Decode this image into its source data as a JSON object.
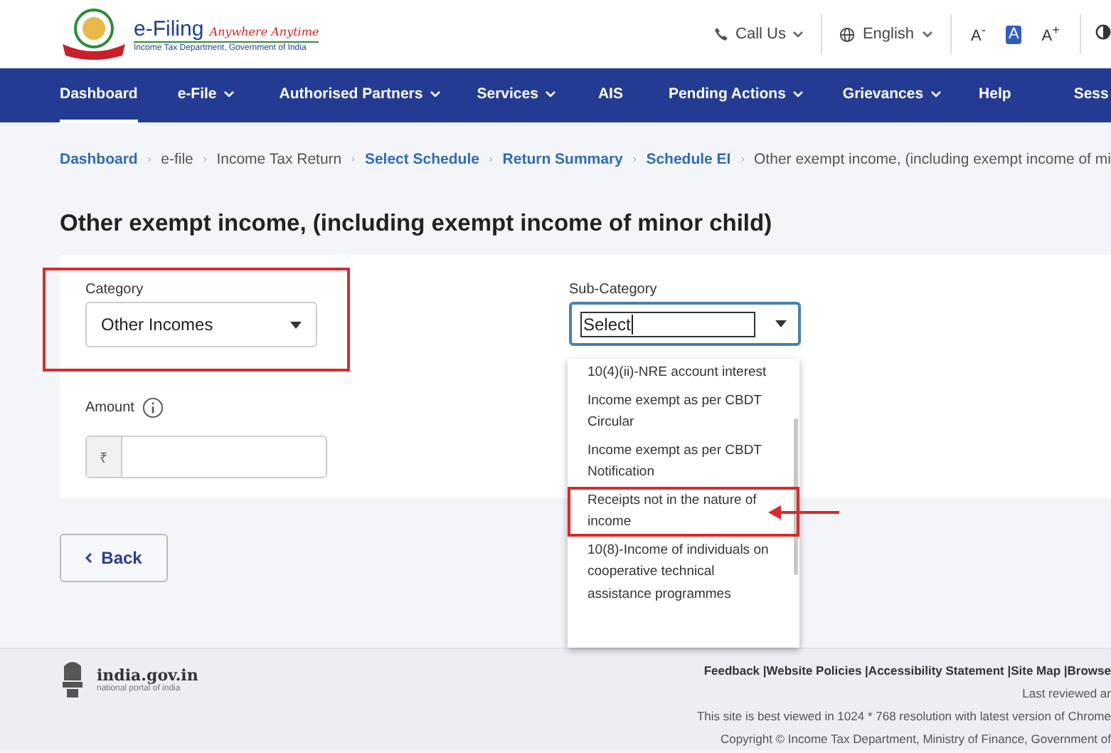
{
  "header": {
    "logo_title": "e-Filing",
    "logo_tagline": "Anywhere Anytime",
    "logo_subtitle": "Income Tax Department, Government of India",
    "call_us": "Call Us",
    "language": "English",
    "font_buttons": [
      {
        "label": "A$^{-}$",
        "selected": false
      },
      {
        "label": "A",
        "selected": true
      },
      {
        "label": "A$^{+}$",
        "selected": false
      }
    ]
  },
  "nav": [
    {
      "label": "Dashboard",
      "selected": true,
      "dropdown": false
    },
    {
      "label": "e-File",
      "selected": false,
      "dropdown": true
    },
    {
      "label": "Authorised Partners",
      "selected": false,
      "dropdown": true
    },
    {
      "label": "Services",
      "selected": false,
      "dropdown": true
    },
    {
      "label": "AIS",
      "selected": false,
      "dropdown": false
    },
    {
      "label": "Pending Actions",
      "selected": false,
      "dropdown": true
    },
    {
      "label": "Grievances",
      "selected": false,
      "dropdown": true
    },
    {
      "label": "Help",
      "selected": false,
      "dropdown": false
    },
    {
      "label": "Sess",
      "selected": false,
      "dropdown": false
    }
  ],
  "breadcrumb": [
    {
      "label": "Dashboard",
      "link": true
    },
    {
      "label": "e-file",
      "link": false
    },
    {
      "label": "Income Tax Return",
      "link": false
    },
    {
      "label": "Select Schedule",
      "link": true
    },
    {
      "label": "Return Summary",
      "link": true
    },
    {
      "label": "Schedule EI",
      "link": true
    },
    {
      "label": "Other exempt income, (including exempt income of mi",
      "link": false
    }
  ],
  "heading": "Other exempt income, (including exempt income of minor child)",
  "category": {
    "label": "Category",
    "value": "Other Incomes",
    "highlighted": true
  },
  "sub_category": {
    "label": "Sub-Category",
    "value": "Select",
    "options": [
      {
        "label": "10(4)(ii)-NRE account interest",
        "highlighted": false
      },
      {
        "label": "Income exempt as per CBDT Circular",
        "highlighted": false
      },
      {
        "label": "Income exempt as per CBDT Notification",
        "highlighted": false
      },
      {
        "label": "Receipts not in the nature of income",
        "highlighted": true
      },
      {
        "label": "10(8)-Income of individuals on cooperative technical assistance programmes",
        "highlighted": false
      }
    ]
  },
  "amount": {
    "label": "Amount",
    "currency": "₹"
  },
  "back_button": "Back",
  "footer": {
    "portal_title": "india.gov.in",
    "portal_subtitle": "national portal of india",
    "links": "Feedback |Website Policies |Accessibility Statement |Site Map |Browse",
    "lines": [
      "Last reviewed ar",
      "This site is best viewed in 1024 * 768 resolution with latest version of Chrome",
      "Copyright © Income Tax Department, Ministry of Finance, Government of"
    ]
  }
}
